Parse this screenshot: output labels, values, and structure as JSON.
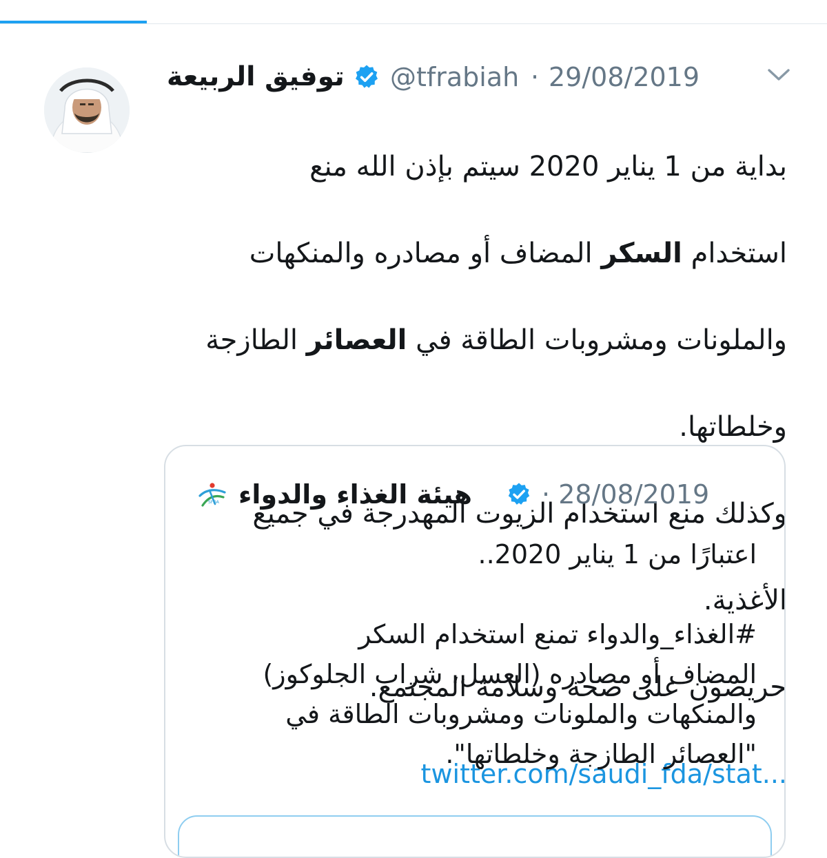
{
  "colors": {
    "accent": "#1da1f2",
    "link": "#1b95e0",
    "muted": "#657786",
    "verified": "#1da1f2"
  },
  "tweet": {
    "author_name": "توفيق الربيعة",
    "handle": "@tfrabiah",
    "separator": "·",
    "date": "29/08/2019",
    "verified_icon": "verified-badge-icon",
    "menu_icon": "chevron-down-icon",
    "lines": [
      {
        "text": "بداية من 1 يناير 2020 سيتم بإذن الله منع"
      },
      {
        "before": "استخدام ",
        "bold": "السكر",
        "after": " المضاف أو مصادره والمنكهات"
      },
      {
        "before": "والملونات ومشروبات الطاقة في ",
        "bold": "العصائر",
        "after": " الطازجة"
      },
      {
        "text": "وخلطاتها."
      },
      {
        "text": "وكذلك منع استخدام الزيوت المهدرجة في جميع"
      },
      {
        "text": "الأغذية."
      },
      {
        "text": "حريصون على صحة وسلامة المجتمع."
      }
    ],
    "link_text": "twitter.com/saudi_fda/stat..."
  },
  "quoted_tweet": {
    "author_name": "هيئة الغذاء والدواء",
    "separator": "·",
    "date": "28/08/2019",
    "logo_icon": "sfda-logo-icon",
    "verified_icon": "verified-badge-icon",
    "lines": [
      "اعتبارًا من 1 يناير 2020..",
      "",
      "#الغذاء_والدواء تمنع استخدام السكر",
      "المضاف أو مصادره (العسل، شراب الجلوكوز)",
      "والمنكهات والملونات ومشروبات الطاقة في",
      "\"العصائر الطازجة وخلطاتها\"."
    ]
  }
}
